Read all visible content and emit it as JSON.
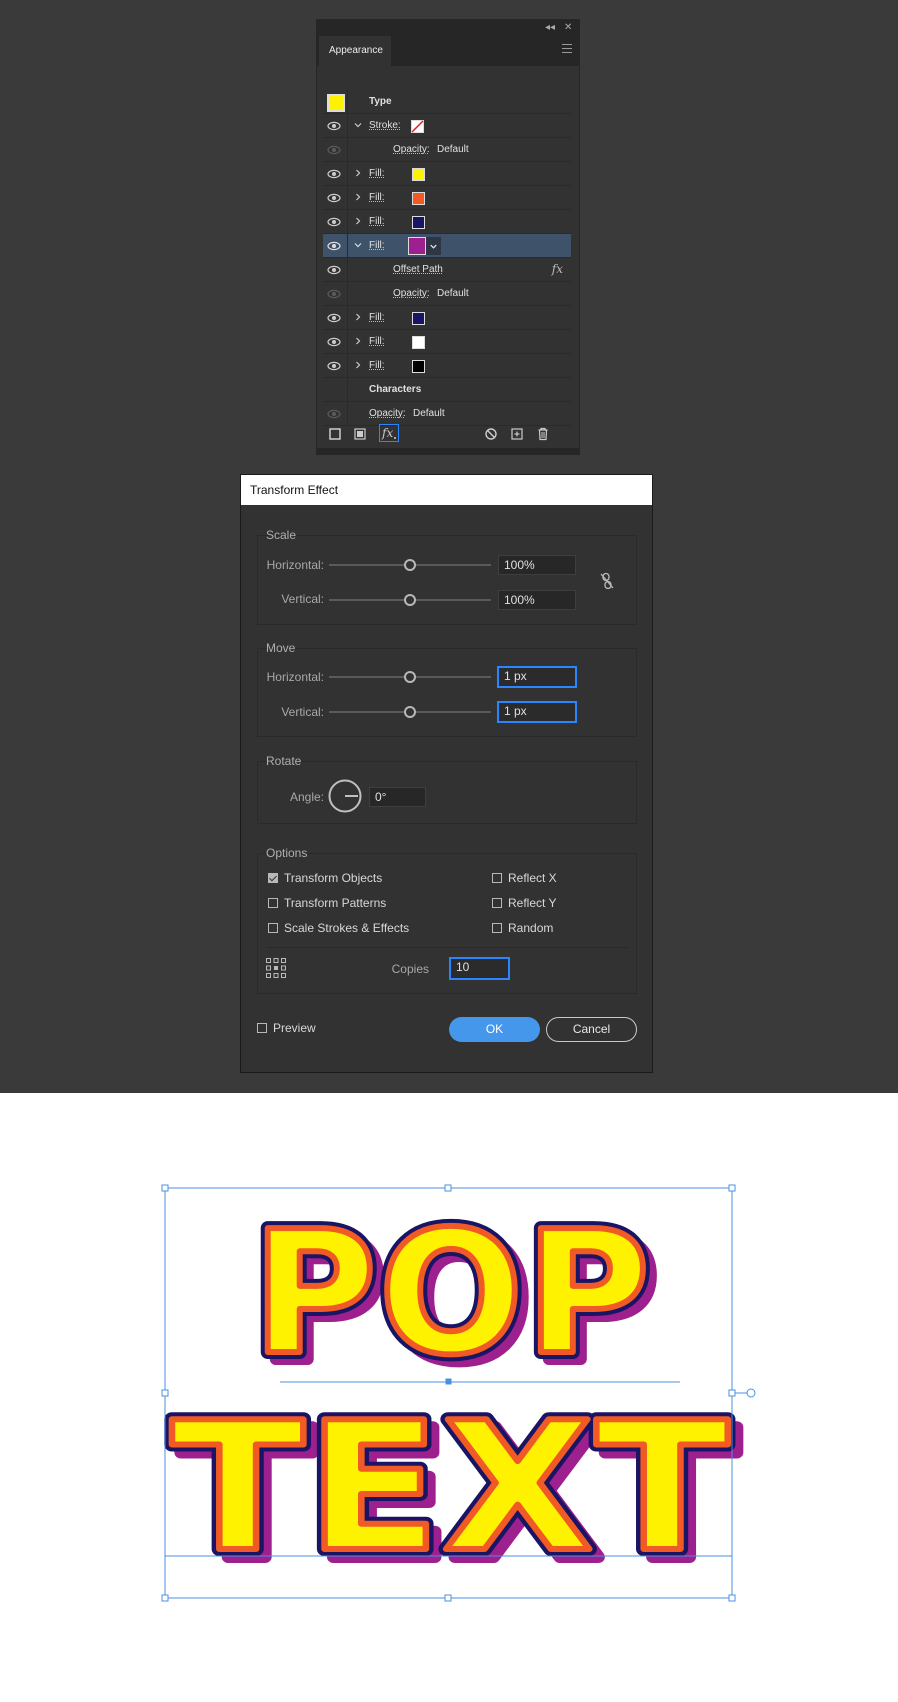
{
  "appearance_panel": {
    "tab_label": "Appearance",
    "header_label": "Type",
    "stroke_label": "Stroke:",
    "opacity_label": "Opacity:",
    "opacity_value": "Default",
    "fill_label": "Fill:",
    "offset_path_label": "Offset Path",
    "fx_glyph": "fx",
    "characters_label": "Characters",
    "fill_colors": [
      "#fff200",
      "#f15a24",
      "#1a1464",
      "#9e1f8e",
      "#1a1464",
      "#ffffff",
      "#000000"
    ],
    "footer_icons": [
      "new-stroke-icon",
      "new-fill-icon",
      "add-effect-icon",
      "clear-appearance-icon",
      "duplicate-item-icon",
      "delete-item-icon"
    ]
  },
  "transform_dialog": {
    "title": "Transform Effect",
    "scale": {
      "title": "Scale",
      "horizontal_label": "Horizontal:",
      "horizontal_value": "100%",
      "vertical_label": "Vertical:",
      "vertical_value": "100%"
    },
    "move": {
      "title": "Move",
      "horizontal_label": "Horizontal:",
      "horizontal_value": "1 px",
      "vertical_label": "Vertical:",
      "vertical_value": "1 px"
    },
    "rotate": {
      "title": "Rotate",
      "angle_label": "Angle:",
      "angle_value": "0°"
    },
    "options": {
      "title": "Options",
      "transform_objects": "Transform Objects",
      "transform_patterns": "Transform Patterns",
      "scale_strokes": "Scale Strokes & Effects",
      "reflect_x": "Reflect X",
      "reflect_y": "Reflect Y",
      "random": "Random",
      "transform_objects_checked": true,
      "copies_label": "Copies",
      "copies_value": "10"
    },
    "preview_label": "Preview",
    "ok_label": "OK",
    "cancel_label": "Cancel"
  },
  "artwork": {
    "line1": "POP",
    "line2": "TEXT",
    "colors": {
      "fill": "#fff200",
      "outline": "#1a1464",
      "orange": "#f15a24",
      "shadow": "#9e1f8e",
      "selection": "#4a90e2"
    }
  }
}
